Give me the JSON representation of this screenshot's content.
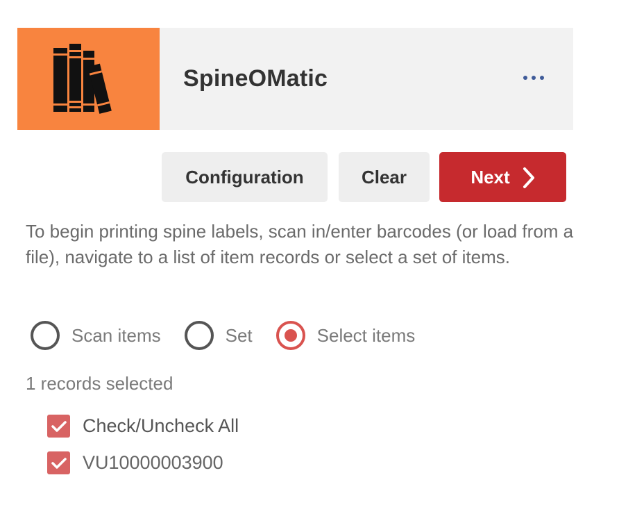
{
  "header": {
    "app_title": "SpineOMatic",
    "logo_icon": "books-icon",
    "more_icon": "more-horizontal-icon",
    "logo_color": "#f8843f"
  },
  "toolbar": {
    "configuration_label": "Configuration",
    "clear_label": "Clear",
    "next_label": "Next",
    "next_icon": "chevron-right-icon",
    "accent_color": "#c62a2e"
  },
  "intro_text": "To begin printing spine labels, scan in/enter barcodes (or load from a file), navigate to a list of item records or select a set of items.",
  "modes": [
    {
      "label": "Scan items",
      "selected": false
    },
    {
      "label": "Set",
      "selected": false
    },
    {
      "label": "Select items",
      "selected": true
    }
  ],
  "records_selected_text": "1 records selected",
  "check_all_label": "Check/Uncheck All",
  "items": [
    {
      "barcode": "VU10000003900",
      "checked": true
    }
  ]
}
